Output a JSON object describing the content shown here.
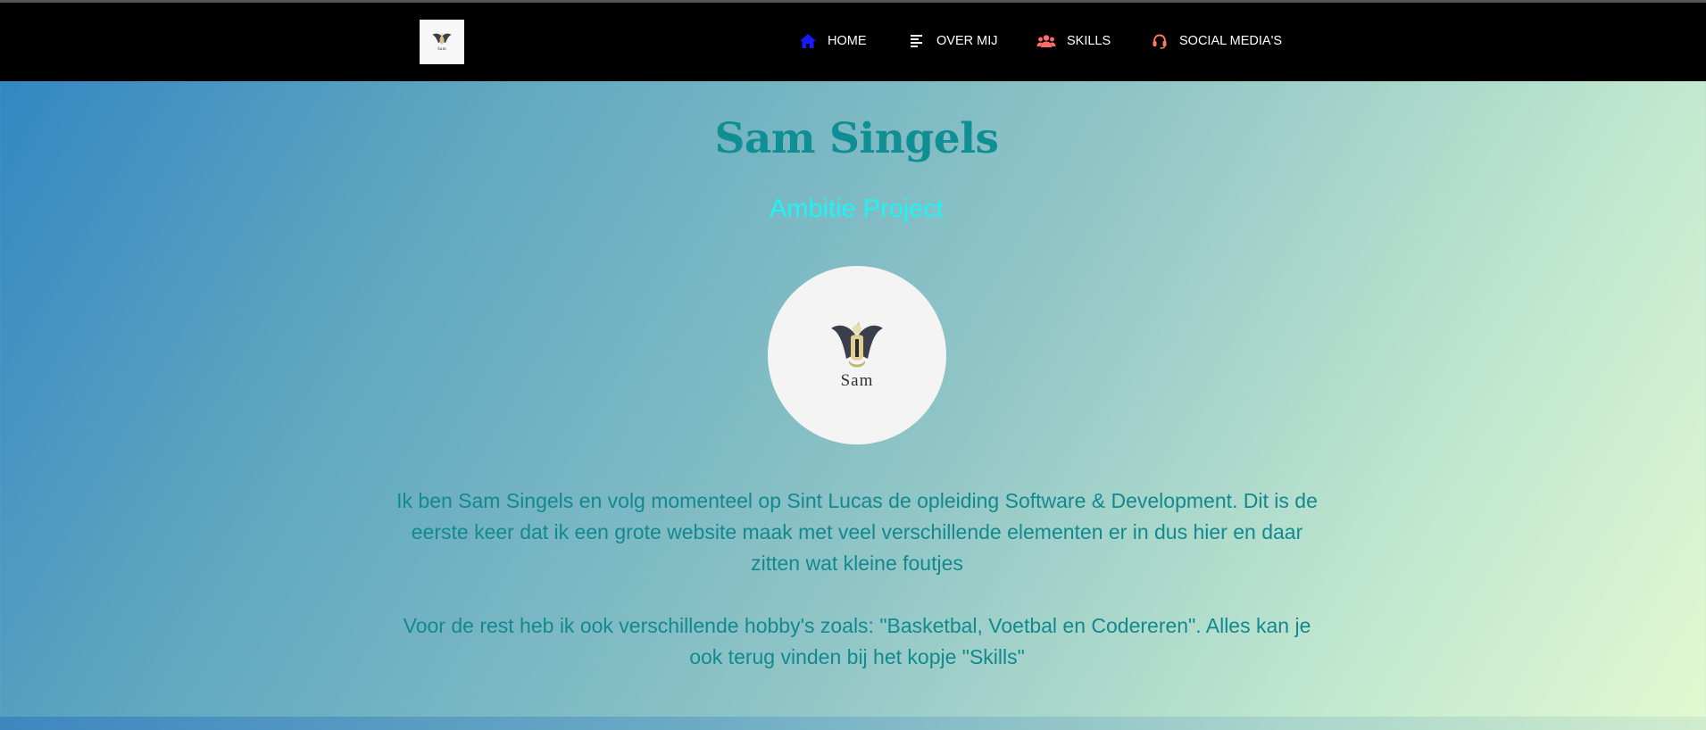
{
  "nav": {
    "logo_text": "Sam",
    "items": [
      {
        "label": "HOME",
        "icon": "home-icon",
        "color": "#1a1aff"
      },
      {
        "label": "OVER MIJ",
        "icon": "text-lines-icon",
        "color": "#ffffff"
      },
      {
        "label": "SKILLS",
        "icon": "users-icon",
        "color": "#ff6b6b"
      },
      {
        "label": "SOCIAL MEDIA'S",
        "icon": "headset-icon",
        "color": "#ff7b5c"
      }
    ]
  },
  "hero": {
    "title": "Sam Singels",
    "subtitle": "Ambitie Project",
    "avatar_text": "Sam"
  },
  "intro": {
    "paragraph_1": "Ik ben Sam Singels en volg momenteel op Sint Lucas de opleiding Software & Development. Dit is de eerste keer dat ik een grote website maak met veel verschillende elementen er in dus hier en daar zitten wat kleine foutjes",
    "paragraph_2": "Voor de rest heb ik ook verschillende hobby's zoals: \"Basketbal, Voetbal en Codereren\". Alles kan je ook terug vinden bij het kopje \"Skills\""
  },
  "colors": {
    "title": "#0f8f93",
    "subtitle": "#1df5f5",
    "body_text": "#12898e",
    "navbar_bg": "#000000"
  }
}
